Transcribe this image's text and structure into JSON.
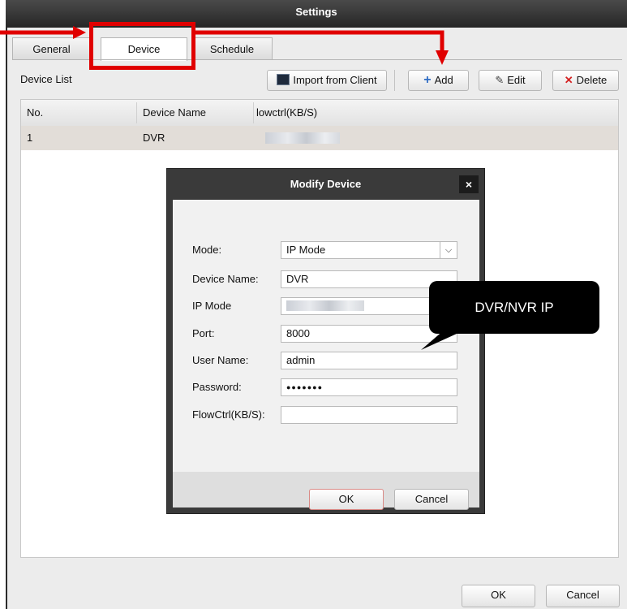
{
  "window": {
    "title": "Settings"
  },
  "tabs": [
    {
      "label": "General"
    },
    {
      "label": "Device"
    },
    {
      "label": "Schedule"
    }
  ],
  "toolbar": {
    "section_label": "Device List",
    "import_label": "Import from Client",
    "add_label": "Add",
    "edit_label": "Edit",
    "delete_label": "Delete"
  },
  "table": {
    "columns": [
      "No.",
      "Device Name",
      "lowctrl(KB/S)"
    ],
    "rows": [
      {
        "no": "1",
        "name": "DVR"
      }
    ]
  },
  "dialog": {
    "title": "Modify Device",
    "close": "×",
    "fields": [
      {
        "label": "Mode:",
        "value": "IP Mode"
      },
      {
        "label": "Device Name:",
        "value": "DVR"
      },
      {
        "label": "IP Mode",
        "value": ""
      },
      {
        "label": "Port:",
        "value": "8000"
      },
      {
        "label": "User Name:",
        "value": "admin"
      },
      {
        "label": "Password:",
        "value": "●●●●●●●"
      },
      {
        "label": "FlowCtrl(KB/S):",
        "value": ""
      }
    ],
    "ok_label": "OK",
    "cancel_label": "Cancel"
  },
  "footer": {
    "ok_label": "OK",
    "cancel_label": "Cancel"
  },
  "annotation": {
    "callout_text": "DVR/NVR IP"
  },
  "colors": {
    "highlight": "#e00000",
    "titlebar": "#2e2e2e",
    "selected_row": "#e2ddd8"
  }
}
